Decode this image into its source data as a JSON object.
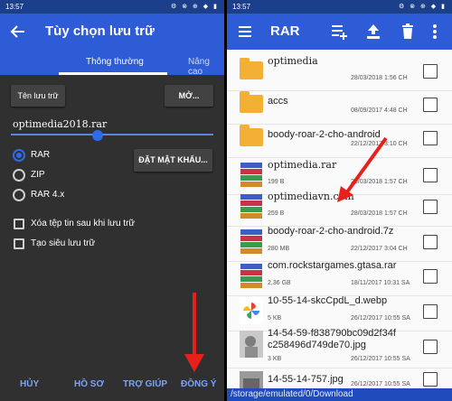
{
  "left": {
    "status_time": "13:57",
    "status_icons": "⚙ ⊗ ⊕ ◆ ▮",
    "title": "Tùy chọn lưu trữ",
    "tabs": [
      "Thông thường",
      "Nâng cao"
    ],
    "name_button": "Tên lưu trữ",
    "open_button": "MỞ...",
    "filename": "optimedia2018.rar",
    "formats": [
      "RAR",
      "ZIP",
      "RAR 4.x"
    ],
    "selected_format": "RAR",
    "password_button": "ĐẶT MẬT KHẨU...",
    "options": [
      "Xóa tệp tin sau khi lưu trữ",
      "Tạo siêu lưu trữ"
    ],
    "footer": [
      "HỦY",
      "HỒ SƠ",
      "TRỢ GIÚP",
      "ĐỒNG Ý"
    ]
  },
  "right": {
    "status_time": "13:57",
    "status_icons": "⚙ ⊗ ⊕ ◆ ▮",
    "title": "RAR",
    "files": [
      {
        "name": "optimedia",
        "type": "folder",
        "size": "",
        "date": "28/03/2018 1:56 CH"
      },
      {
        "name": "accs",
        "type": "folder",
        "size": "",
        "date": "08/09/2017 4:48 CH"
      },
      {
        "name": "boody-roar-2-cho-android",
        "type": "folder",
        "size": "",
        "date": "22/12/2017 3:10 CH"
      },
      {
        "name": "optimedia.rar",
        "type": "rar",
        "size": "199 B",
        "date": "28/03/2018 1:57 CH"
      },
      {
        "name": "optimediavn.com",
        "type": "rar",
        "size": "259 B",
        "date": "28/03/2018 1:57 CH"
      },
      {
        "name": "boody-roar-2-cho-android.7z",
        "type": "rar",
        "size": "280 MB",
        "date": "22/12/2017 3:04 CH"
      },
      {
        "name": "com.rockstargames.gtasa.rar",
        "type": "rar",
        "size": "2,36 GB",
        "date": "18/11/2017 10:31 SA"
      },
      {
        "name": "10-55-14-skcCpdL_d.webp",
        "type": "photos",
        "size": "5 KB",
        "date": "26/12/2017 10:55 SA"
      },
      {
        "name": "14-54-59-f838790bc09d2f34f",
        "name2": "c258496d749de70.jpg",
        "type": "photo",
        "size": "3 KB",
        "date": "26/12/2017 10:55 SA"
      },
      {
        "name": "14-55-14-757.jpg",
        "type": "photo2",
        "size": "",
        "date": "26/12/2017 10:55 SA"
      }
    ],
    "path": "/storage/emulated/0/Download"
  }
}
